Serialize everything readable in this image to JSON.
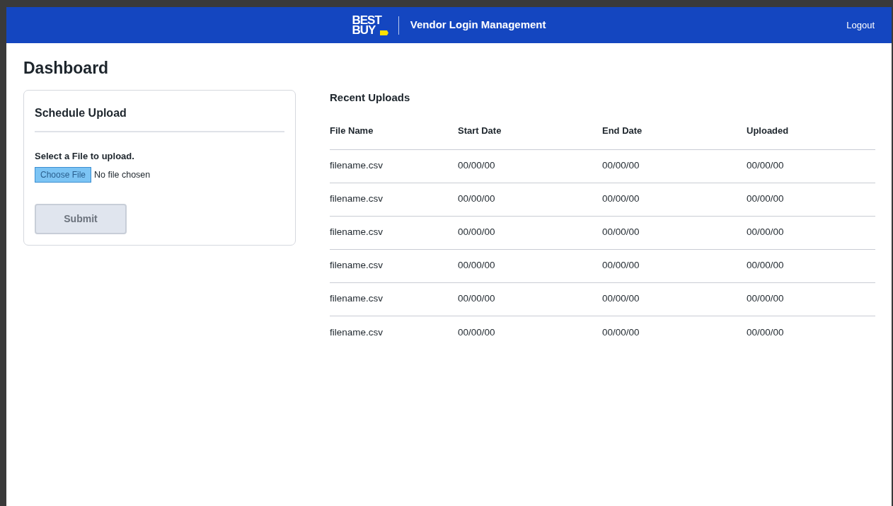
{
  "header": {
    "logo_lines": [
      "BEST",
      "BUY"
    ],
    "title": "Vendor Login Management",
    "logout": "Logout"
  },
  "page_title": "Dashboard",
  "upload_card": {
    "title": "Schedule Upload",
    "label": "Select a File to upload.",
    "choose_button": "Choose File",
    "file_status": "No file chosen",
    "submit": {
      "label": "Submit",
      "disabled": true
    }
  },
  "recent_uploads": {
    "title": "Recent Uploads",
    "columns": [
      "File Name",
      "Start Date",
      "End Date",
      "Uploaded"
    ],
    "rows": [
      [
        "filename.csv",
        "00/00/00",
        "00/00/00",
        "00/00/00"
      ],
      [
        "filename.csv",
        "00/00/00",
        "00/00/00",
        "00/00/00"
      ],
      [
        "filename.csv",
        "00/00/00",
        "00/00/00",
        "00/00/00"
      ],
      [
        "filename.csv",
        "00/00/00",
        "00/00/00",
        "00/00/00"
      ],
      [
        "filename.csv",
        "00/00/00",
        "00/00/00",
        "00/00/00"
      ],
      [
        "filename.csv",
        "00/00/00",
        "00/00/00",
        "00/00/00"
      ]
    ]
  }
}
